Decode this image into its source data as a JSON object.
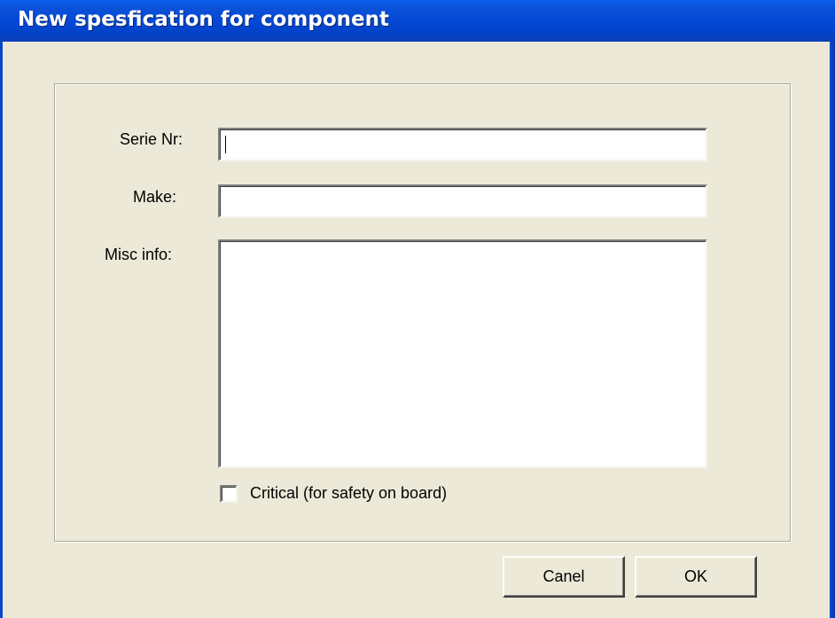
{
  "window": {
    "title": "New spesfication for component"
  },
  "form": {
    "serie_nr": {
      "label": "Serie Nr:",
      "value": ""
    },
    "make": {
      "label": "Make:",
      "value": ""
    },
    "misc_info": {
      "label": "Misc info:",
      "value": ""
    },
    "critical": {
      "label": "Critical (for safety on board)",
      "checked": false
    }
  },
  "buttons": {
    "cancel_label": "Canel",
    "ok_label": "OK"
  }
}
